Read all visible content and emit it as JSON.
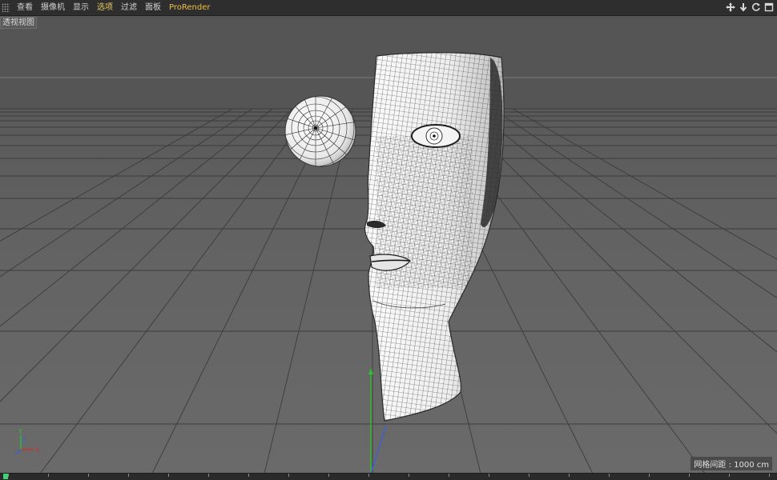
{
  "menubar": {
    "items": [
      {
        "label": "查看",
        "active": false
      },
      {
        "label": "摄像机",
        "active": false
      },
      {
        "label": "显示",
        "active": false
      },
      {
        "label": "选项",
        "active": true
      },
      {
        "label": "过滤",
        "active": false
      },
      {
        "label": "面板",
        "active": false
      },
      {
        "label": "ProRender",
        "active": false
      }
    ],
    "nav_icons": [
      "move-view-icon",
      "zoom-view-icon",
      "rotate-view-icon",
      "maximize-view-icon"
    ]
  },
  "viewport": {
    "label": "透视视图",
    "grid_spacing": "网格间距 : 1000 cm",
    "axes": {
      "x": "X",
      "y": "Y",
      "z": "Z"
    }
  },
  "colors": {
    "menubar_bg": "#2e2e2e",
    "active_menu": "#e8c860",
    "plugin_menu": "#f0c040",
    "axis_x": "#d03030",
    "axis_y": "#30c030",
    "axis_z": "#3060d0"
  }
}
